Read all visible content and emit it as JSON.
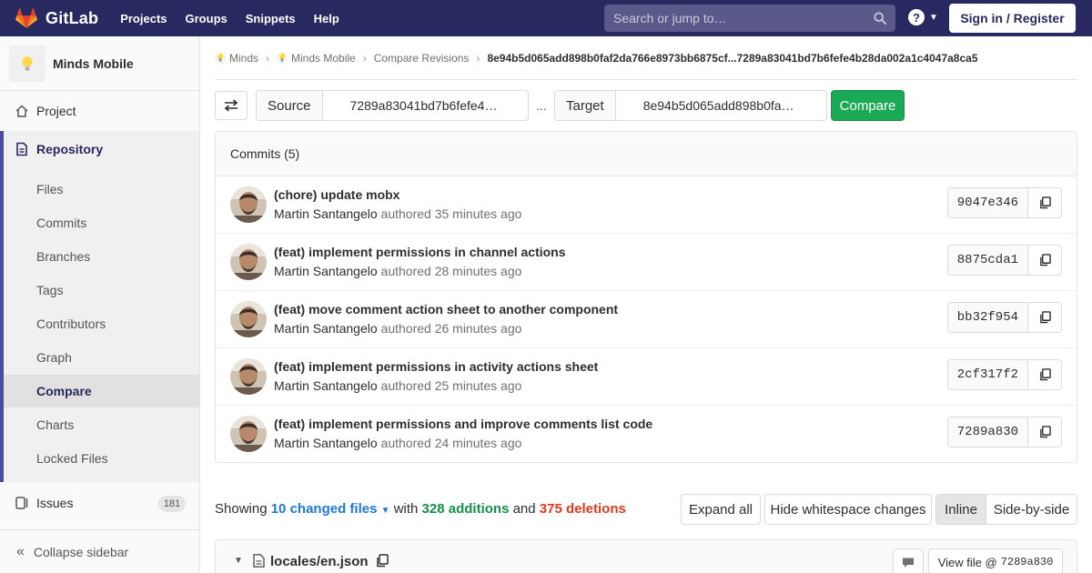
{
  "nav": {
    "brand": "GitLab",
    "links": [
      "Projects",
      "Groups",
      "Snippets",
      "Help"
    ],
    "search_placeholder": "Search or jump to…",
    "help_label": "?",
    "signin_label": "Sign in / Register"
  },
  "sidebar": {
    "project_name": "Minds Mobile",
    "project_label": "Project",
    "repository_label": "Repository",
    "repo_items": [
      "Files",
      "Commits",
      "Branches",
      "Tags",
      "Contributors",
      "Graph",
      "Compare",
      "Charts",
      "Locked Files"
    ],
    "active_item": "Compare",
    "issues_label": "Issues",
    "issues_count": "181",
    "collapse_label": "Collapse sidebar"
  },
  "breadcrumb": {
    "items": [
      "Minds",
      "Minds Mobile",
      "Compare Revisions"
    ],
    "current": "8e94b5d065add898b0faf2da766e8973bb6875cf...7289a83041bd7b6fefe4b28da002a1c4047a8ca5"
  },
  "compare_form": {
    "source_label": "Source",
    "source_value": "7289a83041bd7b6fefe4…",
    "separator": "...",
    "target_label": "Target",
    "target_value": "8e94b5d065add898b0fa…",
    "compare_button": "Compare"
  },
  "commits": {
    "header": "Commits (5)",
    "list": [
      {
        "title": "(chore) update mobx",
        "author": "Martin Santangelo",
        "authored": "authored 35 minutes ago",
        "sha": "9047e346"
      },
      {
        "title": "(feat) implement permissions in channel actions",
        "author": "Martin Santangelo",
        "authored": "authored 28 minutes ago",
        "sha": "8875cda1"
      },
      {
        "title": "(feat) move comment action sheet to another component",
        "author": "Martin Santangelo",
        "authored": "authored 26 minutes ago",
        "sha": "bb32f954"
      },
      {
        "title": "(feat) implement permissions in activity actions sheet",
        "author": "Martin Santangelo",
        "authored": "authored 25 minutes ago",
        "sha": "2cf317f2"
      },
      {
        "title": "(feat) implement permissions and improve comments list code",
        "author": "Martin Santangelo",
        "authored": "authored 24 minutes ago",
        "sha": "7289a830"
      }
    ]
  },
  "diff_summary": {
    "showing": "Showing",
    "files": "10 changed files",
    "with": "with",
    "additions": "328 additions",
    "and": "and",
    "deletions": "375 deletions",
    "expand_all": "Expand all",
    "hide_whitespace": "Hide whitespace changes",
    "inline": "Inline",
    "side_by_side": "Side-by-side"
  },
  "file": {
    "name": "locales/en.json",
    "view_file_label": "View file @",
    "view_file_sha": "7289a830"
  },
  "colors": {
    "nav_bg": "#292961",
    "accent": "#4b4ba3",
    "compare_green": "#1aaa55",
    "additions": "#168f48",
    "deletions": "#db3b21",
    "link": "#1f78d1"
  }
}
